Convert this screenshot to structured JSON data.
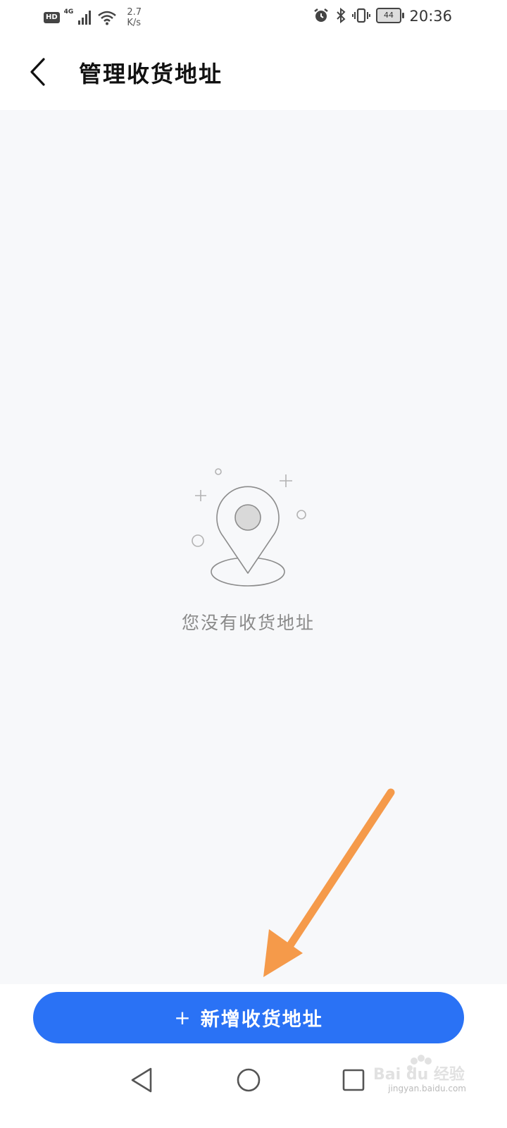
{
  "status_bar": {
    "hd": "HD",
    "network": "4G",
    "speed_value": "2.7",
    "speed_unit": "K/s",
    "battery": "44",
    "time": "20:36"
  },
  "header": {
    "title": "管理收货地址"
  },
  "empty_state": {
    "message": "您没有收货地址"
  },
  "actions": {
    "add_icon": "+",
    "add_label": "新增收货地址"
  },
  "colors": {
    "accent": "#2a72f5",
    "arrow": "#f59a4a",
    "background": "#f7f8fa"
  },
  "watermark": {
    "brand": "Bai du 经验",
    "url": "jingyan.baidu.com"
  }
}
